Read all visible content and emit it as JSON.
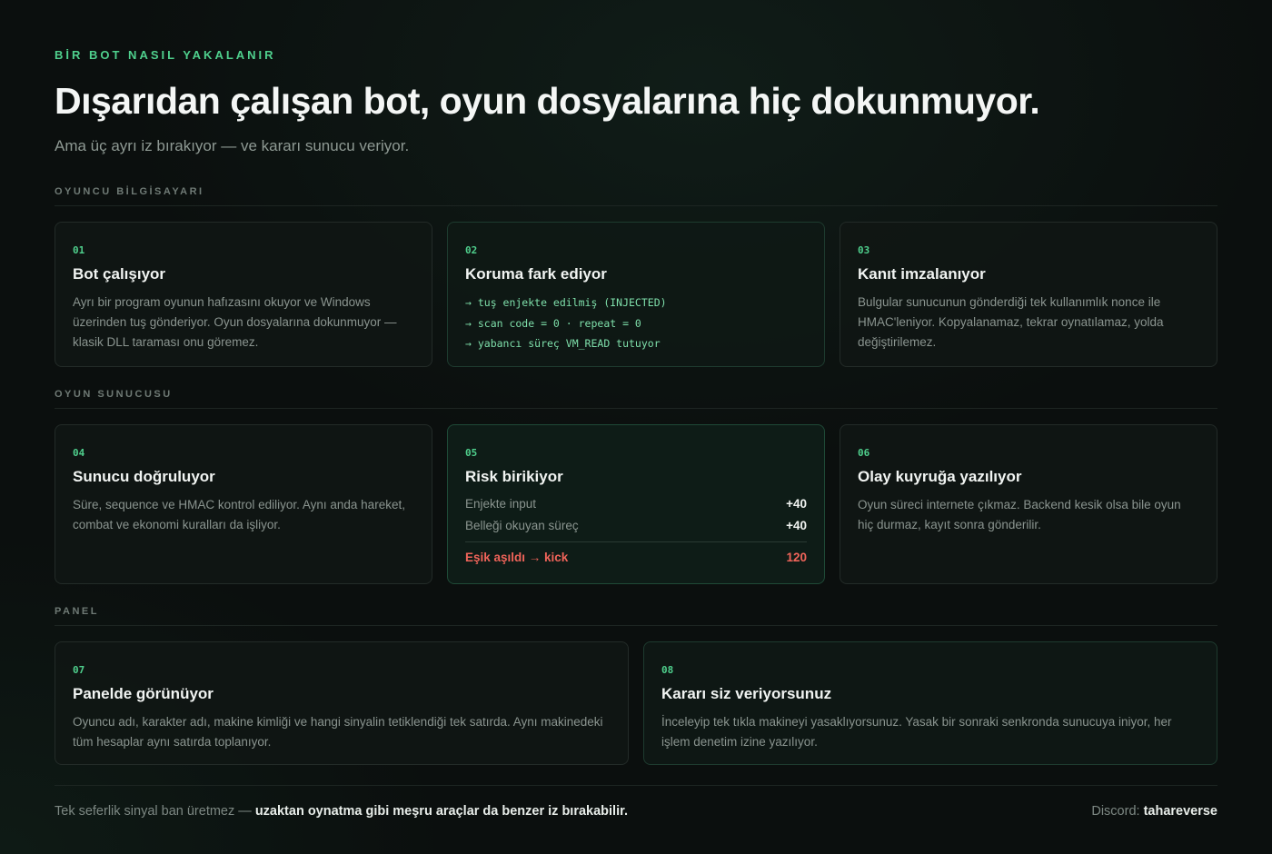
{
  "header": {
    "eyebrow": "BİR BOT NASIL YAKALANIR",
    "title": "Dışarıdan çalışan bot, oyun dosyalarına hiç dokunmuyor.",
    "subtitle": "Ama üç ayrı iz bırakıyor — ve kararı sunucu veriyor."
  },
  "sections": [
    {
      "label": "OYUNCU BİLGİSAYARI",
      "cards": [
        {
          "num": "01",
          "title": "Bot çalışıyor",
          "desc": "Ayrı bir program oyunun hafızasını okuyor ve Windows üzerinden tuş gönderiyor. Oyun dosyalarına dokunmuyor — klasik DLL taraması onu göremez."
        },
        {
          "num": "02",
          "title": "Koruma fark ediyor",
          "lines": [
            "→ tuş enjekte edilmiş (INJECTED)",
            "→ scan code = 0 · repeat = 0",
            "→ yabancı süreç VM_READ tutuyor"
          ]
        },
        {
          "num": "03",
          "title": "Kanıt imzalanıyor",
          "desc": "Bulgular sunucunun gönderdiği tek kullanımlık nonce ile HMAC'leniyor. Kopyalanamaz, tekrar oynatılamaz, yolda değiştirilemez."
        }
      ]
    },
    {
      "label": "OYUN SUNUCUSU",
      "cards": [
        {
          "num": "04",
          "title": "Sunucu doğruluyor",
          "desc": "Süre, sequence ve HMAC kontrol ediliyor. Aynı anda hareket, combat ve ekonomi kuralları da işliyor."
        },
        {
          "num": "05",
          "title": "Risk birikiyor",
          "rows": [
            {
              "label": "Enjekte input",
              "value": "+40"
            },
            {
              "label": "Belleği okuyan süreç",
              "value": "+40"
            }
          ],
          "total": {
            "label": "Eşik aşıldı → kick",
            "value": "120"
          }
        },
        {
          "num": "06",
          "title": "Olay kuyruğa yazılıyor",
          "desc": "Oyun süreci internete çıkmaz. Backend kesik olsa bile oyun hiç durmaz, kayıt sonra gönderilir."
        }
      ]
    },
    {
      "label": "PANEL",
      "cards": [
        {
          "num": "07",
          "title": "Panelde görünüyor",
          "desc": "Oyuncu adı, karakter adı, makine kimliği ve hangi sinyalin tetiklendiği tek satırda. Aynı makinedeki tüm hesaplar aynı satırda toplanıyor."
        },
        {
          "num": "08",
          "title": "Kararı siz veriyorsunuz",
          "desc": "İnceleyip tek tıkla makineyi yasaklıyorsunuz. Yasak bir sonraki senkronda sunucuya iniyor, her işlem denetim izine yazılıyor."
        }
      ]
    }
  ],
  "footer": {
    "note_plain": "Tek seferlik sinyal ban üretmez — ",
    "note_bold": "uzaktan oynatma gibi meşru araçlar da benzer iz bırakabilir.",
    "contact_label": "Discord: ",
    "contact_value": "tahareverse"
  },
  "colors": {
    "accent": "#4fd08d",
    "danger": "#f0645a",
    "background": "#0b0f0e"
  }
}
